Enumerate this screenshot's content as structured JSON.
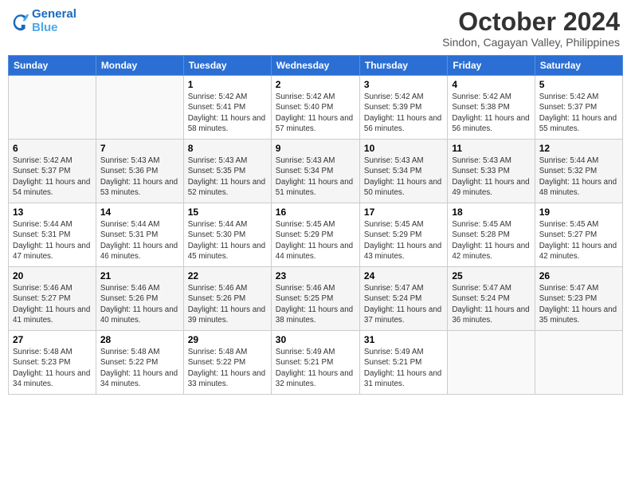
{
  "logo": {
    "line1": "General",
    "line2": "Blue"
  },
  "title": "October 2024",
  "subtitle": "Sindon, Cagayan Valley, Philippines",
  "weekdays": [
    "Sunday",
    "Monday",
    "Tuesday",
    "Wednesday",
    "Thursday",
    "Friday",
    "Saturday"
  ],
  "weeks": [
    [
      {
        "day": "",
        "info": ""
      },
      {
        "day": "",
        "info": ""
      },
      {
        "day": "1",
        "info": "Sunrise: 5:42 AM\nSunset: 5:41 PM\nDaylight: 11 hours and 58 minutes."
      },
      {
        "day": "2",
        "info": "Sunrise: 5:42 AM\nSunset: 5:40 PM\nDaylight: 11 hours and 57 minutes."
      },
      {
        "day": "3",
        "info": "Sunrise: 5:42 AM\nSunset: 5:39 PM\nDaylight: 11 hours and 56 minutes."
      },
      {
        "day": "4",
        "info": "Sunrise: 5:42 AM\nSunset: 5:38 PM\nDaylight: 11 hours and 56 minutes."
      },
      {
        "day": "5",
        "info": "Sunrise: 5:42 AM\nSunset: 5:37 PM\nDaylight: 11 hours and 55 minutes."
      }
    ],
    [
      {
        "day": "6",
        "info": "Sunrise: 5:42 AM\nSunset: 5:37 PM\nDaylight: 11 hours and 54 minutes."
      },
      {
        "day": "7",
        "info": "Sunrise: 5:43 AM\nSunset: 5:36 PM\nDaylight: 11 hours and 53 minutes."
      },
      {
        "day": "8",
        "info": "Sunrise: 5:43 AM\nSunset: 5:35 PM\nDaylight: 11 hours and 52 minutes."
      },
      {
        "day": "9",
        "info": "Sunrise: 5:43 AM\nSunset: 5:34 PM\nDaylight: 11 hours and 51 minutes."
      },
      {
        "day": "10",
        "info": "Sunrise: 5:43 AM\nSunset: 5:34 PM\nDaylight: 11 hours and 50 minutes."
      },
      {
        "day": "11",
        "info": "Sunrise: 5:43 AM\nSunset: 5:33 PM\nDaylight: 11 hours and 49 minutes."
      },
      {
        "day": "12",
        "info": "Sunrise: 5:44 AM\nSunset: 5:32 PM\nDaylight: 11 hours and 48 minutes."
      }
    ],
    [
      {
        "day": "13",
        "info": "Sunrise: 5:44 AM\nSunset: 5:31 PM\nDaylight: 11 hours and 47 minutes."
      },
      {
        "day": "14",
        "info": "Sunrise: 5:44 AM\nSunset: 5:31 PM\nDaylight: 11 hours and 46 minutes."
      },
      {
        "day": "15",
        "info": "Sunrise: 5:44 AM\nSunset: 5:30 PM\nDaylight: 11 hours and 45 minutes."
      },
      {
        "day": "16",
        "info": "Sunrise: 5:45 AM\nSunset: 5:29 PM\nDaylight: 11 hours and 44 minutes."
      },
      {
        "day": "17",
        "info": "Sunrise: 5:45 AM\nSunset: 5:29 PM\nDaylight: 11 hours and 43 minutes."
      },
      {
        "day": "18",
        "info": "Sunrise: 5:45 AM\nSunset: 5:28 PM\nDaylight: 11 hours and 42 minutes."
      },
      {
        "day": "19",
        "info": "Sunrise: 5:45 AM\nSunset: 5:27 PM\nDaylight: 11 hours and 42 minutes."
      }
    ],
    [
      {
        "day": "20",
        "info": "Sunrise: 5:46 AM\nSunset: 5:27 PM\nDaylight: 11 hours and 41 minutes."
      },
      {
        "day": "21",
        "info": "Sunrise: 5:46 AM\nSunset: 5:26 PM\nDaylight: 11 hours and 40 minutes."
      },
      {
        "day": "22",
        "info": "Sunrise: 5:46 AM\nSunset: 5:26 PM\nDaylight: 11 hours and 39 minutes."
      },
      {
        "day": "23",
        "info": "Sunrise: 5:46 AM\nSunset: 5:25 PM\nDaylight: 11 hours and 38 minutes."
      },
      {
        "day": "24",
        "info": "Sunrise: 5:47 AM\nSunset: 5:24 PM\nDaylight: 11 hours and 37 minutes."
      },
      {
        "day": "25",
        "info": "Sunrise: 5:47 AM\nSunset: 5:24 PM\nDaylight: 11 hours and 36 minutes."
      },
      {
        "day": "26",
        "info": "Sunrise: 5:47 AM\nSunset: 5:23 PM\nDaylight: 11 hours and 35 minutes."
      }
    ],
    [
      {
        "day": "27",
        "info": "Sunrise: 5:48 AM\nSunset: 5:23 PM\nDaylight: 11 hours and 34 minutes."
      },
      {
        "day": "28",
        "info": "Sunrise: 5:48 AM\nSunset: 5:22 PM\nDaylight: 11 hours and 34 minutes."
      },
      {
        "day": "29",
        "info": "Sunrise: 5:48 AM\nSunset: 5:22 PM\nDaylight: 11 hours and 33 minutes."
      },
      {
        "day": "30",
        "info": "Sunrise: 5:49 AM\nSunset: 5:21 PM\nDaylight: 11 hours and 32 minutes."
      },
      {
        "day": "31",
        "info": "Sunrise: 5:49 AM\nSunset: 5:21 PM\nDaylight: 11 hours and 31 minutes."
      },
      {
        "day": "",
        "info": ""
      },
      {
        "day": "",
        "info": ""
      }
    ]
  ]
}
